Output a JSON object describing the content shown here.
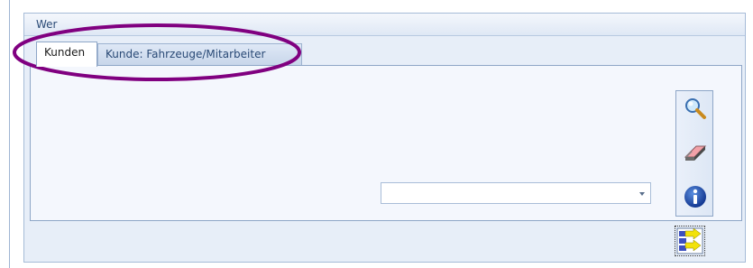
{
  "group": {
    "title": "Wer"
  },
  "tabs": [
    {
      "label": "Kunden",
      "active": true
    },
    {
      "label": "Kunde: Fahrzeuge/Mitarbeiter",
      "active": false
    }
  ],
  "dropdown": {
    "value": ""
  },
  "toolbar": {
    "buttons": [
      {
        "icon": "magnifier-icon"
      },
      {
        "icon": "eraser-icon"
      },
      {
        "icon": "info-icon"
      }
    ]
  },
  "bottom_button": {
    "icon": "transfer-arrows-icon"
  },
  "colors": {
    "highlight": "#800080",
    "accent": "#1e395b",
    "panel_bg": "#f4f7fd"
  }
}
